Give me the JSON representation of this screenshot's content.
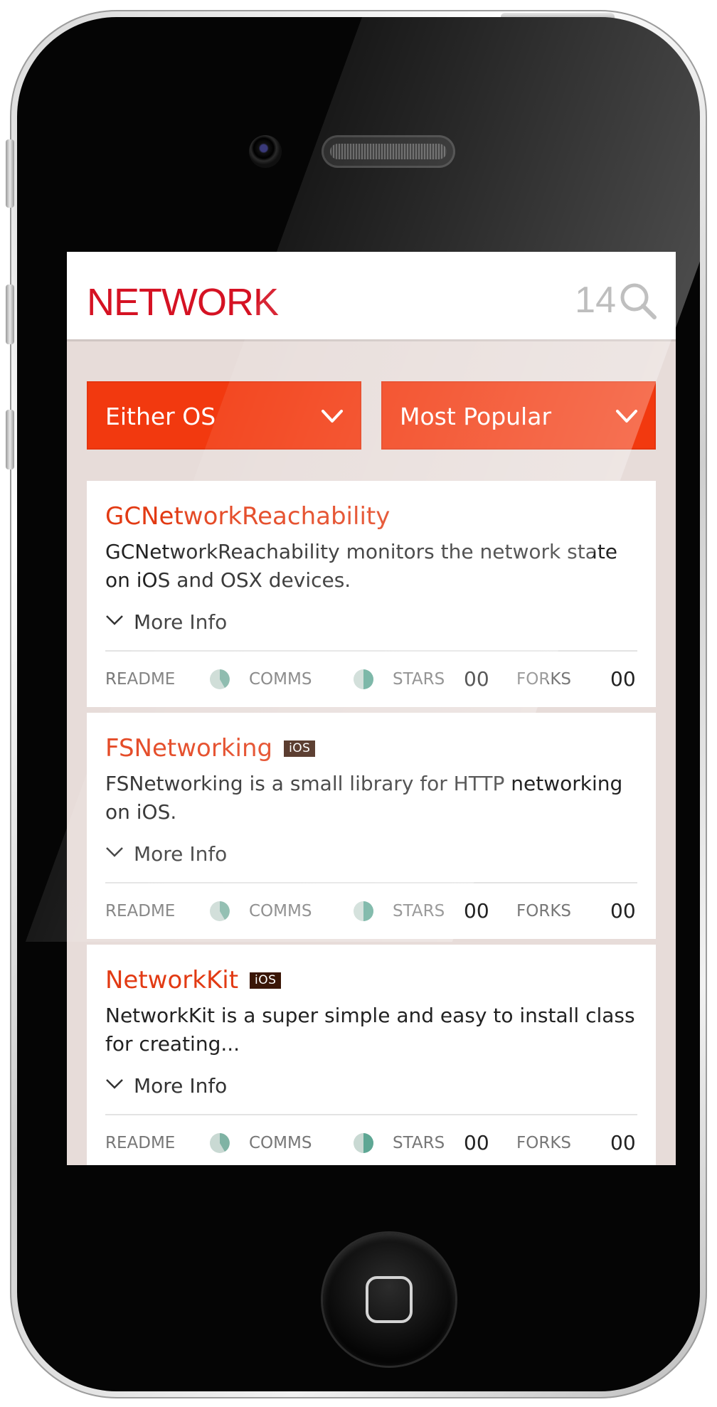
{
  "header": {
    "title": "NETWORK",
    "count": "14"
  },
  "filters": {
    "os": "Either OS",
    "sort": "Most Popular"
  },
  "stat_labels": {
    "readme": "README",
    "comms": "COMMS",
    "stars": "STARS",
    "forks": "FORKS"
  },
  "more_info_label": "More Info",
  "cards": [
    {
      "title": "GCNetworkReachability",
      "badge": "",
      "description": "GCNetworkReachability monitors the network state on iOS and OSX devices.",
      "stars": "00",
      "forks": "00"
    },
    {
      "title": "FSNetworking",
      "badge": "iOS",
      "description": "FSNetworking is a small library for HTTP networking on iOS.",
      "stars": "00",
      "forks": "00"
    },
    {
      "title": "NetworkKit",
      "badge": "iOS",
      "description": "NetworkKit is a super simple and easy to install class for creating...",
      "stars": "00",
      "forks": "00"
    }
  ],
  "colors": {
    "accent": "#f2390f",
    "title_red": "#d51223",
    "card_title": "#e23a13",
    "badge_bg": "#3a1606",
    "screen_bg": "#e7dcd9"
  }
}
